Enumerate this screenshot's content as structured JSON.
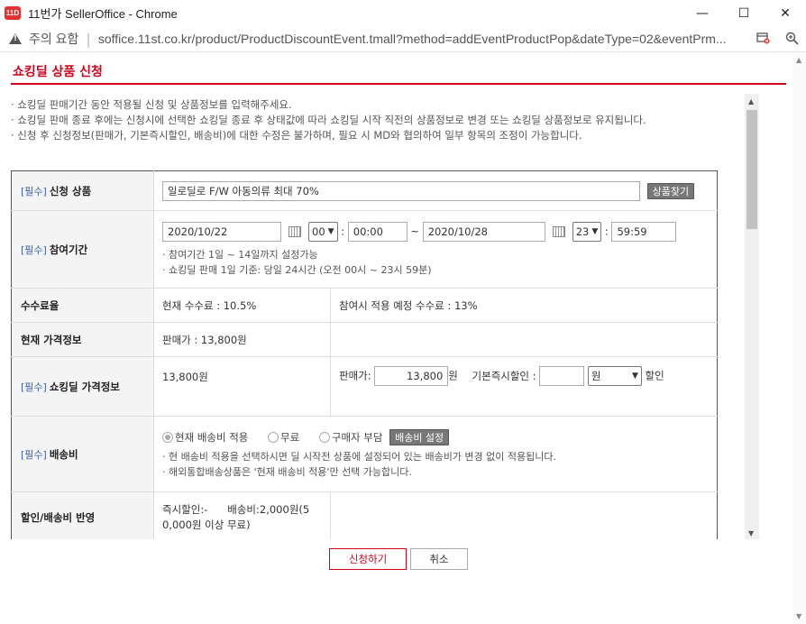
{
  "window": {
    "app_icon_text": "11D",
    "title": "11번가 SellerOffice - Chrome",
    "minimize": "—",
    "maximize": "☐",
    "close": "✕"
  },
  "addressbar": {
    "warning": "주의 요함",
    "url": "soffice.11st.co.kr/product/ProductDiscountEvent.tmall?method=addEventProductPop&dateType=02&eventPrm..."
  },
  "popup": {
    "title": "쇼킹딜 상품 신청",
    "notes": [
      "· 쇼킹딜 판매기간 동안 적용될 신청 및 상품정보를 입력해주세요.",
      "· 쇼킹딜 판매 종료 후에는 신청시에 선택한 쇼킹딜 종료 후 상태값에 따라 쇼킹딜 시작 직전의 상품정보로 변경 또는 쇼킹딜 상품정보로 유지됩니다.",
      "· 신청 후 신청정보(판매가, 기본즉시할인, 배송비)에 대한 수정은 불가하며, 필요 시 MD와 협의하여 일부 항목의 조정이 가능합니다."
    ]
  },
  "form": {
    "required_tag": "[필수]",
    "product": {
      "label": "신청 상품",
      "value": "일로딜로 F/W 아동의류 최대 70%",
      "search_button": "상품찾기"
    },
    "period": {
      "label": "참여기간",
      "start_date": "2020/10/22",
      "start_hour": "00",
      "start_time": "00:00",
      "tilde": "~",
      "end_date": "2020/10/28",
      "end_hour": "23",
      "end_time": "59:59",
      "colon": ":",
      "hint1": "· 참여기간 1일 ~ 14일까지 설정가능",
      "hint2": "· 쇼킹딜 판매 1일 기준: 당일 24시간 (오전 00시 ~ 23시 59분)"
    },
    "fee": {
      "label": "수수료율",
      "current": "현재 수수료 : 10.5%",
      "expected": "참여시 적용 예정 수수료 : 13%"
    },
    "current_price": {
      "label": "현재 가격정보",
      "value": "판매가 : 13,800원"
    },
    "deal_price": {
      "label": "쇼킹딜 가격정보",
      "current_value": "13,800원",
      "sale_price_label": "판매가:",
      "sale_price_value": "13,800",
      "won": "원",
      "discount_label": "기본즉시할인 :",
      "discount_value": "",
      "discount_unit": "원",
      "discount_suffix": "할인"
    },
    "shipping": {
      "label": "배송비",
      "option_current": "현재 배송비 적용",
      "option_free": "무료",
      "option_buyer": "구매자 부담",
      "setting_button": "배송비 설정",
      "hint1": "· 현 배송비 적용을 선택하시면 딜 시작전 상품에 설정되어 있는 배송비가 변경 없이 적용됩니다.",
      "hint2": "· 해외통합배송상품은 '현재 배송비 적용'만 선택 가능합니다."
    },
    "reflect": {
      "label": "할인/배송비 반영",
      "line1": "즉시할인:-      배송비:2,000원(5",
      "line2": "0,000원 이상 무료)"
    }
  },
  "actions": {
    "submit": "신청하기",
    "cancel": "취소"
  }
}
